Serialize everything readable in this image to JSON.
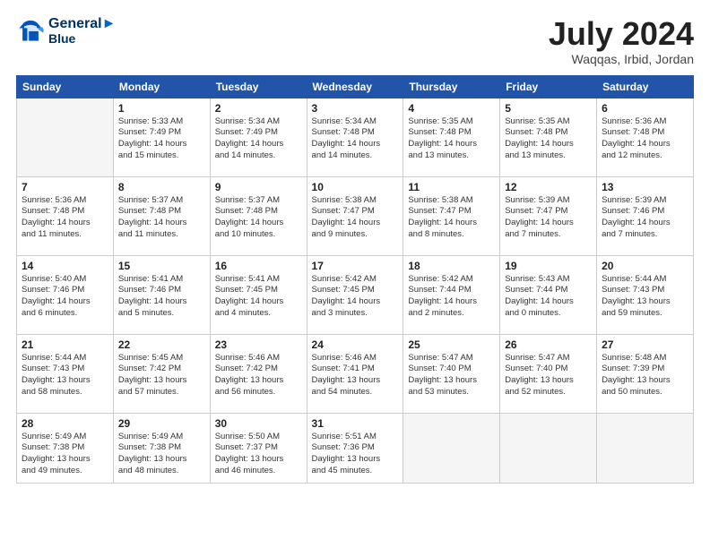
{
  "header": {
    "logo_line1": "General",
    "logo_line2": "Blue",
    "month": "July 2024",
    "location": "Waqqas, Irbid, Jordan"
  },
  "days_of_week": [
    "Sunday",
    "Monday",
    "Tuesday",
    "Wednesday",
    "Thursday",
    "Friday",
    "Saturday"
  ],
  "weeks": [
    [
      {
        "day": "",
        "info": ""
      },
      {
        "day": "1",
        "info": "Sunrise: 5:33 AM\nSunset: 7:49 PM\nDaylight: 14 hours\nand 15 minutes."
      },
      {
        "day": "2",
        "info": "Sunrise: 5:34 AM\nSunset: 7:49 PM\nDaylight: 14 hours\nand 14 minutes."
      },
      {
        "day": "3",
        "info": "Sunrise: 5:34 AM\nSunset: 7:48 PM\nDaylight: 14 hours\nand 14 minutes."
      },
      {
        "day": "4",
        "info": "Sunrise: 5:35 AM\nSunset: 7:48 PM\nDaylight: 14 hours\nand 13 minutes."
      },
      {
        "day": "5",
        "info": "Sunrise: 5:35 AM\nSunset: 7:48 PM\nDaylight: 14 hours\nand 13 minutes."
      },
      {
        "day": "6",
        "info": "Sunrise: 5:36 AM\nSunset: 7:48 PM\nDaylight: 14 hours\nand 12 minutes."
      }
    ],
    [
      {
        "day": "7",
        "info": "Sunrise: 5:36 AM\nSunset: 7:48 PM\nDaylight: 14 hours\nand 11 minutes."
      },
      {
        "day": "8",
        "info": "Sunrise: 5:37 AM\nSunset: 7:48 PM\nDaylight: 14 hours\nand 11 minutes."
      },
      {
        "day": "9",
        "info": "Sunrise: 5:37 AM\nSunset: 7:48 PM\nDaylight: 14 hours\nand 10 minutes."
      },
      {
        "day": "10",
        "info": "Sunrise: 5:38 AM\nSunset: 7:47 PM\nDaylight: 14 hours\nand 9 minutes."
      },
      {
        "day": "11",
        "info": "Sunrise: 5:38 AM\nSunset: 7:47 PM\nDaylight: 14 hours\nand 8 minutes."
      },
      {
        "day": "12",
        "info": "Sunrise: 5:39 AM\nSunset: 7:47 PM\nDaylight: 14 hours\nand 7 minutes."
      },
      {
        "day": "13",
        "info": "Sunrise: 5:39 AM\nSunset: 7:46 PM\nDaylight: 14 hours\nand 7 minutes."
      }
    ],
    [
      {
        "day": "14",
        "info": "Sunrise: 5:40 AM\nSunset: 7:46 PM\nDaylight: 14 hours\nand 6 minutes."
      },
      {
        "day": "15",
        "info": "Sunrise: 5:41 AM\nSunset: 7:46 PM\nDaylight: 14 hours\nand 5 minutes."
      },
      {
        "day": "16",
        "info": "Sunrise: 5:41 AM\nSunset: 7:45 PM\nDaylight: 14 hours\nand 4 minutes."
      },
      {
        "day": "17",
        "info": "Sunrise: 5:42 AM\nSunset: 7:45 PM\nDaylight: 14 hours\nand 3 minutes."
      },
      {
        "day": "18",
        "info": "Sunrise: 5:42 AM\nSunset: 7:44 PM\nDaylight: 14 hours\nand 2 minutes."
      },
      {
        "day": "19",
        "info": "Sunrise: 5:43 AM\nSunset: 7:44 PM\nDaylight: 14 hours\nand 0 minutes."
      },
      {
        "day": "20",
        "info": "Sunrise: 5:44 AM\nSunset: 7:43 PM\nDaylight: 13 hours\nand 59 minutes."
      }
    ],
    [
      {
        "day": "21",
        "info": "Sunrise: 5:44 AM\nSunset: 7:43 PM\nDaylight: 13 hours\nand 58 minutes."
      },
      {
        "day": "22",
        "info": "Sunrise: 5:45 AM\nSunset: 7:42 PM\nDaylight: 13 hours\nand 57 minutes."
      },
      {
        "day": "23",
        "info": "Sunrise: 5:46 AM\nSunset: 7:42 PM\nDaylight: 13 hours\nand 56 minutes."
      },
      {
        "day": "24",
        "info": "Sunrise: 5:46 AM\nSunset: 7:41 PM\nDaylight: 13 hours\nand 54 minutes."
      },
      {
        "day": "25",
        "info": "Sunrise: 5:47 AM\nSunset: 7:40 PM\nDaylight: 13 hours\nand 53 minutes."
      },
      {
        "day": "26",
        "info": "Sunrise: 5:47 AM\nSunset: 7:40 PM\nDaylight: 13 hours\nand 52 minutes."
      },
      {
        "day": "27",
        "info": "Sunrise: 5:48 AM\nSunset: 7:39 PM\nDaylight: 13 hours\nand 50 minutes."
      }
    ],
    [
      {
        "day": "28",
        "info": "Sunrise: 5:49 AM\nSunset: 7:38 PM\nDaylight: 13 hours\nand 49 minutes."
      },
      {
        "day": "29",
        "info": "Sunrise: 5:49 AM\nSunset: 7:38 PM\nDaylight: 13 hours\nand 48 minutes."
      },
      {
        "day": "30",
        "info": "Sunrise: 5:50 AM\nSunset: 7:37 PM\nDaylight: 13 hours\nand 46 minutes."
      },
      {
        "day": "31",
        "info": "Sunrise: 5:51 AM\nSunset: 7:36 PM\nDaylight: 13 hours\nand 45 minutes."
      },
      {
        "day": "",
        "info": ""
      },
      {
        "day": "",
        "info": ""
      },
      {
        "day": "",
        "info": ""
      }
    ]
  ]
}
